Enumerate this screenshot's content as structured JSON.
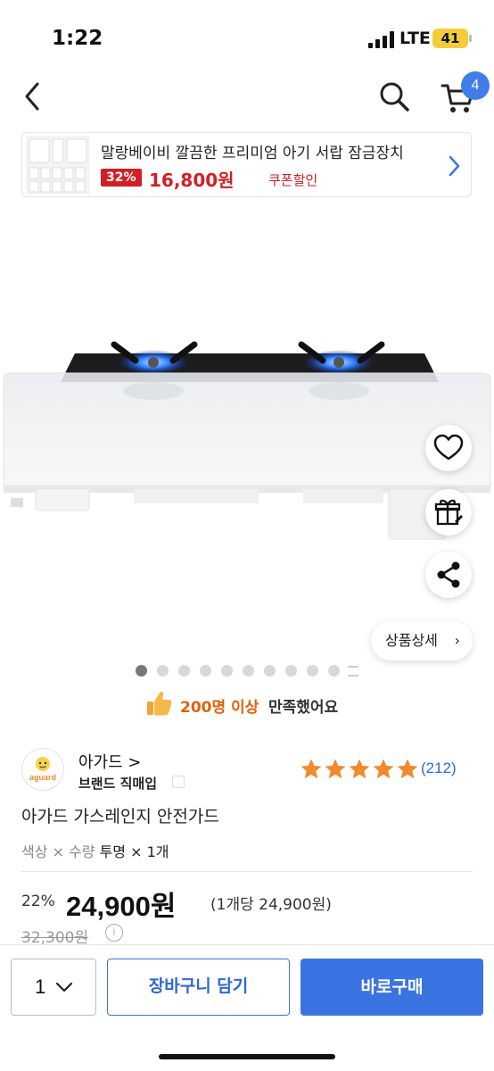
{
  "status_bar": {
    "time": "1:22",
    "network": "LTE",
    "battery": "41"
  },
  "nav": {
    "cart_count": "4",
    "icons": [
      "back-arrow-icon",
      "search-icon",
      "cart-icon"
    ]
  },
  "ad_banner": {
    "title": "말랑베이비 깔끔한 프리미엄 아기 서랍 잠금장치",
    "discount": "32%",
    "price": "16,800원",
    "coupon": "쿠폰할인"
  },
  "product_image": {
    "detail_button": "상품상세",
    "slide_count": 10,
    "active_slide": 0
  },
  "satisfaction": {
    "count": "200명 이상",
    "text": "만족했어요"
  },
  "seller": {
    "name": "아가드 >",
    "type": "브랜드 직매입",
    "rating": 5,
    "review_count": "(212)"
  },
  "product": {
    "title": "아가드 가스레인지 안전가드",
    "option_label": "색상 × 수량",
    "option_value": "투명 × 1개",
    "discount_rate": "22%",
    "price": "24,900원",
    "unit_price": "(1개당 24,900원)",
    "original_price": "32,300원"
  },
  "bottom_bar": {
    "quantity": "1",
    "add_to_cart": "장바구니 담기",
    "buy_now": "바로구매"
  },
  "colors": {
    "accent_blue": "#3a73e2",
    "sale_red": "#d21f25",
    "satisfaction_orange": "#e0620a",
    "star_orange": "#f08a2c"
  }
}
